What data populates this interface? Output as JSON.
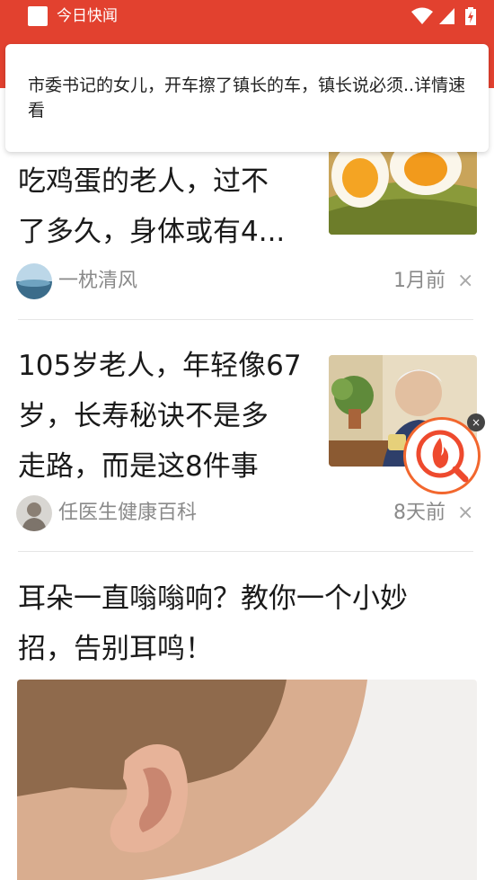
{
  "status_bar": {
    "app_title": "今日快闻",
    "icons": [
      "app-square-icon",
      "wifi-icon",
      "signal-icon",
      "battery-charging-icon"
    ],
    "background": "#e2412f"
  },
  "notification": {
    "text": "市委书记的女儿，开车擦了镇长的车，镇长说必须..详情速看"
  },
  "feed": [
    {
      "title_lines": [
        "吃鸡蛋的老人，过不",
        "了多久，身体或有4..."
      ],
      "image": "boiled-eggs-photo",
      "author": "一枕清风",
      "time": "1月前",
      "dismiss": "×"
    },
    {
      "title_lines": [
        "105岁老人，年轻像67",
        "岁，长寿秘诀不是多",
        "走路，而是这8件事"
      ],
      "image": "elderly-man-tea-photo",
      "author": "任医生健康百科",
      "time": "8天前",
      "dismiss": "×"
    },
    {
      "title_lines": [
        "耳朵一直嗡嗡响？教你一个小妙",
        "招，告别耳鸣！"
      ],
      "image": "baby-ear-photo"
    }
  ],
  "floating_button": {
    "icon": "fire-search-icon",
    "close": "×",
    "accent": "#f2672e"
  }
}
